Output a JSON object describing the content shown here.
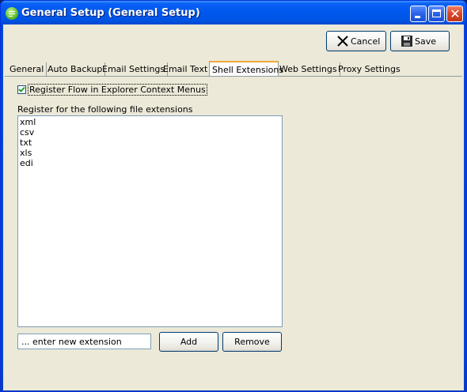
{
  "window": {
    "title": "General Setup (General Setup)",
    "icon": "flow-app-icon"
  },
  "toolbar": {
    "cancel_label": "Cancel",
    "save_label": "Save"
  },
  "tabs": [
    {
      "label": "General",
      "active": false
    },
    {
      "label": "Auto Backup",
      "active": false
    },
    {
      "label": "Email Settings",
      "active": false
    },
    {
      "label": "Email Text",
      "active": false
    },
    {
      "label": "Shell Extensions",
      "active": true
    },
    {
      "label": "Web Settings",
      "active": false
    },
    {
      "label": "Proxy Settings",
      "active": false
    }
  ],
  "shell": {
    "register_checkbox_label": "Register Flow in Explorer Context Menus",
    "register_checked": true,
    "extensions_label": "Register for the following file extensions",
    "extensions": [
      "xml",
      "csv",
      "txt",
      "xls",
      "edi"
    ],
    "new_extension_value": "... enter new extension",
    "add_label": "Add",
    "remove_label": "Remove"
  },
  "colors": {
    "titlebar": "#0058ee",
    "client_bg": "#ece9d8",
    "active_tab_accent": "#f1a83b"
  }
}
